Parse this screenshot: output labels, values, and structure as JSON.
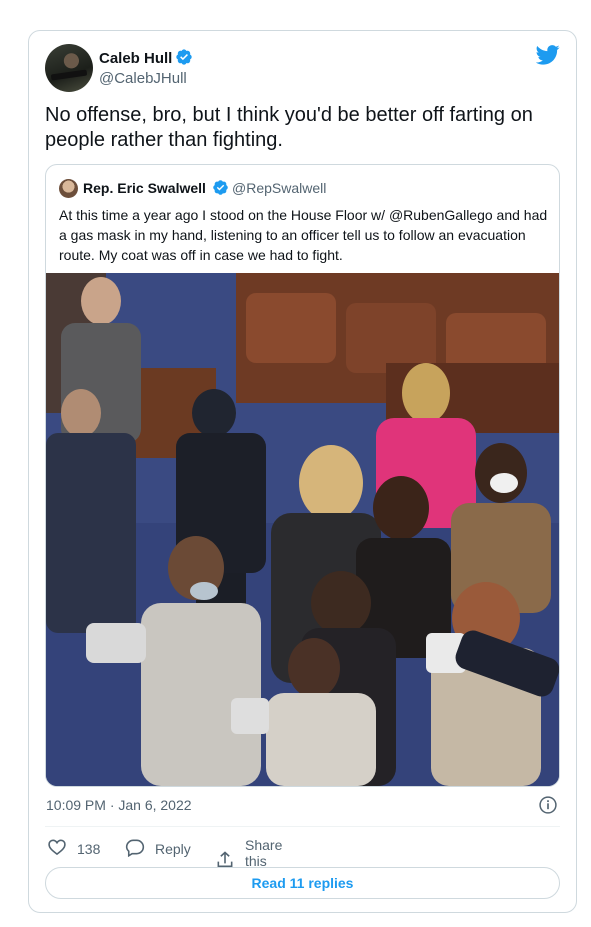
{
  "tweet": {
    "author_name": "Caleb Hull",
    "author_handle": "@CalebJHull",
    "text": "No offense, bro, but I think you'd be better off farting on people rather than fighting.",
    "timestamp": "10:09 PM · Jan 6, 2022",
    "likes": "138",
    "reply_label": "Reply",
    "share_label": "Share this Tweet",
    "read_replies_label": "Read 11 replies"
  },
  "quoted": {
    "author_name": "Rep. Eric Swalwell",
    "author_handle": "@RepSwalwell",
    "text": "At this time a year ago I stood on the House Floor w/ @RubenGallego and had a gas mask in my hand, listening to an officer tell us to follow an evacuation route. My coat was off in case we had to fight."
  },
  "colors": {
    "accent": "#1d9bf0",
    "text_primary": "#0f1419",
    "text_secondary": "#536471",
    "border": "#cfd9de"
  },
  "icons": [
    "verified-badge-icon",
    "twitter-bird-icon",
    "info-icon",
    "heart-icon",
    "reply-icon",
    "share-icon"
  ]
}
